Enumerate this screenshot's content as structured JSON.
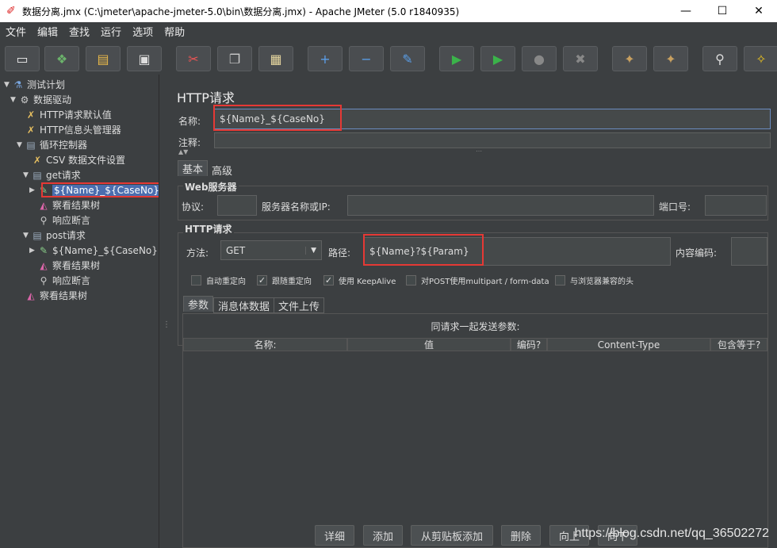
{
  "window": {
    "title": "数据分离.jmx (C:\\jmeter\\apache-jmeter-5.0\\bin\\数据分离.jmx) - Apache JMeter (5.0 r1840935)",
    "minimize": "—",
    "maximize": "☐",
    "close": "✕"
  },
  "menu": [
    "文件",
    "编辑",
    "查找",
    "运行",
    "选项",
    "帮助"
  ],
  "toolbar_icons": [
    "new-icon",
    "templates-icon",
    "open-icon",
    "save-icon",
    "cut-icon",
    "copy-icon",
    "paste-icon",
    "expand-icon",
    "collapse-icon",
    "toggle-icon",
    "start-icon",
    "start-no-pause-icon",
    "stop-icon",
    "shutdown-icon",
    "clear-icon",
    "clear-all-icon",
    "search-icon",
    "reset-search-icon"
  ],
  "toolbar_glyphs": [
    "▭",
    "❖",
    "▤",
    "▣",
    "✂",
    "❐",
    "▦",
    "+",
    "−",
    "✎",
    "▶",
    "▶",
    "●",
    "✖",
    "✦",
    "✦",
    "⚲",
    "✧"
  ],
  "tree": [
    {
      "label": "测试计划",
      "depth": 0,
      "toggle": "▼",
      "icon": "flask-icon",
      "glyph": "⚗"
    },
    {
      "label": "数据驱动",
      "depth": 1,
      "toggle": "▼",
      "icon": "gear-icon",
      "glyph": "⚙"
    },
    {
      "label": "HTTP请求默认值",
      "depth": 2,
      "toggle": "",
      "icon": "tools-icon",
      "glyph": "✗"
    },
    {
      "label": "HTTP信息头管理器",
      "depth": 2,
      "toggle": "",
      "icon": "tools-icon",
      "glyph": "✗"
    },
    {
      "label": "循环控制器",
      "depth": 2,
      "toggle": "▼",
      "icon": "controller-icon",
      "glyph": "▤"
    },
    {
      "label": "CSV 数据文件设置",
      "depth": 3,
      "toggle": "",
      "icon": "tools-icon",
      "glyph": "✗"
    },
    {
      "label": "get请求",
      "depth": 3,
      "toggle": "▼",
      "icon": "controller-icon",
      "glyph": "▤"
    },
    {
      "label": "${Name}_${CaseNo}",
      "depth": 4,
      "toggle": "▶",
      "icon": "sampler-icon",
      "glyph": "✎",
      "selected": true
    },
    {
      "label": "察看结果树",
      "depth": 4,
      "toggle": "",
      "icon": "listener-icon",
      "glyph": "◭"
    },
    {
      "label": "响应断言",
      "depth": 4,
      "toggle": "",
      "icon": "assertion-icon",
      "glyph": "⚲"
    },
    {
      "label": "post请求",
      "depth": 3,
      "toggle": "▼",
      "icon": "controller-icon",
      "glyph": "▤"
    },
    {
      "label": "${Name}_${CaseNo}",
      "depth": 4,
      "toggle": "▶",
      "icon": "sampler-icon",
      "glyph": "✎"
    },
    {
      "label": "察看结果树",
      "depth": 4,
      "toggle": "",
      "icon": "listener-icon",
      "glyph": "◭"
    },
    {
      "label": "响应断言",
      "depth": 4,
      "toggle": "",
      "icon": "assertion-icon",
      "glyph": "⚲"
    },
    {
      "label": "察看结果树",
      "depth": 2,
      "toggle": "",
      "icon": "listener-icon",
      "glyph": "◭"
    }
  ],
  "main": {
    "title": "HTTP请求",
    "name_label": "名称:",
    "name_value": "${Name}_${CaseNo}",
    "comment_label": "注释:",
    "tabs": [
      "基本",
      "高级"
    ],
    "web_server": {
      "title": "Web服务器",
      "protocol_label": "协议:",
      "protocol_value": "",
      "server_label": "服务器名称或IP:",
      "server_value": "",
      "port_label": "端口号:",
      "port_value": ""
    },
    "http_request": {
      "title": "HTTP请求",
      "method_label": "方法:",
      "method_value": "GET",
      "path_label": "路径:",
      "path_value": "${Name}?${Param}",
      "encoding_label": "内容编码:",
      "encoding_value": ""
    },
    "checkboxes": [
      {
        "label": "自动重定向",
        "checked": false
      },
      {
        "label": "跟随重定向",
        "checked": true
      },
      {
        "label": "使用 KeepAlive",
        "checked": true
      },
      {
        "label": "对POST使用multipart / form-data",
        "checked": false
      },
      {
        "label": "与浏览器兼容的头",
        "checked": false
      }
    ],
    "subtabs": [
      "参数",
      "消息体数据",
      "文件上传"
    ],
    "params_caption": "同请求一起发送参数:",
    "columns": [
      "名称:",
      "值",
      "编码?",
      "Content-Type",
      "包含等于?"
    ],
    "buttons": [
      "详细",
      "添加",
      "从剪贴板添加",
      "删除",
      "向上",
      "向下"
    ]
  },
  "watermark": "https://blog.csdn.net/qq_36502272"
}
